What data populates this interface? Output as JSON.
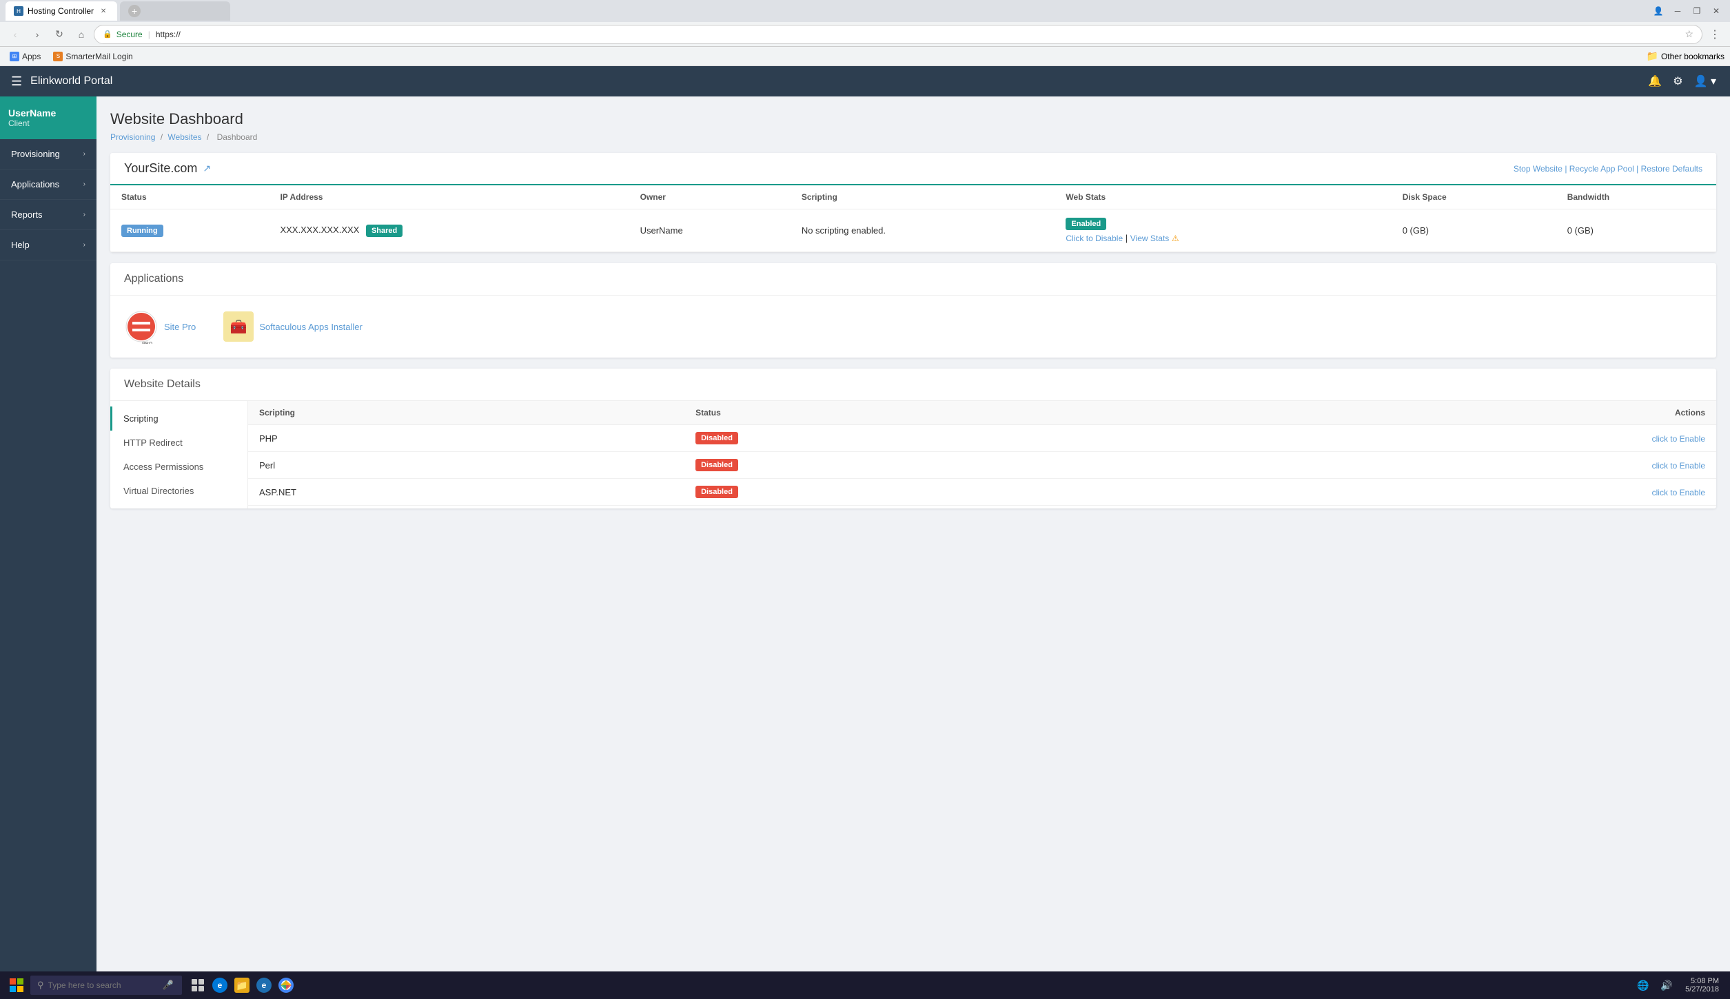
{
  "browser": {
    "tab_active": "Hosting Controller",
    "tab_favicon": "HC",
    "url_secure": "Secure",
    "url": "https://",
    "bookmarks": [
      {
        "label": "Apps",
        "type": "icon"
      },
      {
        "label": "SmarterMail Login",
        "type": "bookmark"
      }
    ],
    "other_bookmarks": "Other bookmarks"
  },
  "app": {
    "brand": "Elinkworld Portal",
    "header_icons": [
      "bell",
      "settings",
      "user"
    ]
  },
  "sidebar": {
    "user_name": "UserName",
    "user_role": "Client",
    "items": [
      {
        "label": "Provisioning",
        "icon": "◦",
        "has_arrow": true
      },
      {
        "label": "Applications",
        "icon": "◦",
        "has_arrow": true
      },
      {
        "label": "Reports",
        "icon": "◦",
        "has_arrow": true
      },
      {
        "label": "Help",
        "icon": "◦",
        "has_arrow": true
      }
    ]
  },
  "main": {
    "page_title": "Website Dashboard",
    "breadcrumb": [
      "Provisioning",
      "Websites",
      "Dashboard"
    ],
    "site_card": {
      "site_name": "YourSite.com",
      "actions": [
        "Stop Website",
        "Recycle App Pool",
        "Restore Defaults"
      ],
      "table": {
        "headers": [
          "Status",
          "IP Address",
          "Owner",
          "Scripting",
          "Web Stats",
          "Disk Space",
          "Bandwidth"
        ],
        "row": {
          "status": "Running",
          "ip": "XXX.XXX.XXX.XXX",
          "ip_type": "Shared",
          "owner": "UserName",
          "scripting": "No scripting enabled.",
          "web_stats_badge": "Enabled",
          "web_stats_disable": "Click to Disable",
          "web_stats_view": "View Stats",
          "disk_space": "0 (GB)",
          "bandwidth": "0 (GB)"
        }
      }
    },
    "applications_card": {
      "title": "Applications",
      "apps": [
        {
          "name": "Site Pro",
          "type": "sitepro"
        },
        {
          "name": "Softaculous Apps Installer",
          "type": "softaculous"
        }
      ]
    },
    "details_card": {
      "title": "Website Details",
      "nav_items": [
        {
          "label": "Scripting",
          "active": true
        },
        {
          "label": "HTTP Redirect"
        },
        {
          "label": "Access Permissions"
        },
        {
          "label": "Virtual Directories"
        }
      ],
      "scripting_table": {
        "headers": [
          "Scripting",
          "Status",
          "Actions"
        ],
        "rows": [
          {
            "scripting": "PHP",
            "status": "Disabled",
            "action": "click to Enable"
          },
          {
            "scripting": "Perl",
            "status": "Disabled",
            "action": "click to Enable"
          },
          {
            "scripting": "ASP.NET",
            "status": "Disabled",
            "action": "click to Enable"
          }
        ]
      }
    }
  },
  "taskbar": {
    "search_placeholder": "Type here to search",
    "time": "5:08 PM",
    "date": "5/27/2018"
  }
}
